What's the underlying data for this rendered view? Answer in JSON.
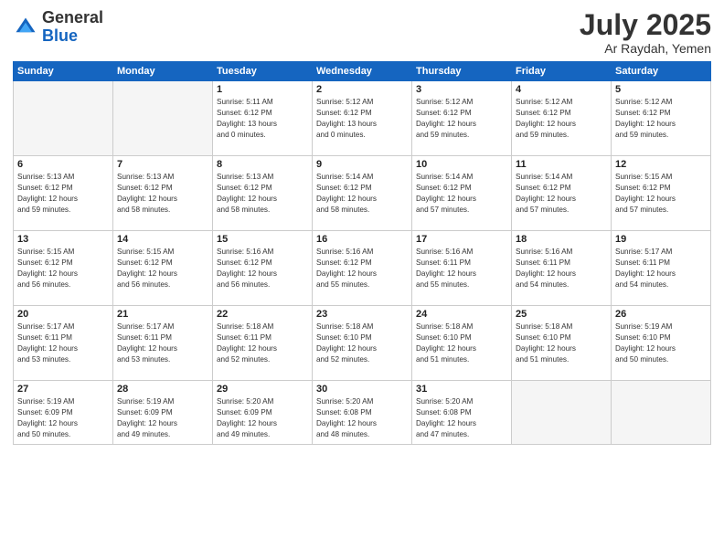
{
  "logo": {
    "general": "General",
    "blue": "Blue"
  },
  "header": {
    "title": "July 2025",
    "subtitle": "Ar Raydah, Yemen"
  },
  "days_of_week": [
    "Sunday",
    "Monday",
    "Tuesday",
    "Wednesday",
    "Thursday",
    "Friday",
    "Saturday"
  ],
  "weeks": [
    [
      {
        "day": "",
        "info": ""
      },
      {
        "day": "",
        "info": ""
      },
      {
        "day": "1",
        "info": "Sunrise: 5:11 AM\nSunset: 6:12 PM\nDaylight: 13 hours\nand 0 minutes."
      },
      {
        "day": "2",
        "info": "Sunrise: 5:12 AM\nSunset: 6:12 PM\nDaylight: 13 hours\nand 0 minutes."
      },
      {
        "day": "3",
        "info": "Sunrise: 5:12 AM\nSunset: 6:12 PM\nDaylight: 12 hours\nand 59 minutes."
      },
      {
        "day": "4",
        "info": "Sunrise: 5:12 AM\nSunset: 6:12 PM\nDaylight: 12 hours\nand 59 minutes."
      },
      {
        "day": "5",
        "info": "Sunrise: 5:12 AM\nSunset: 6:12 PM\nDaylight: 12 hours\nand 59 minutes."
      }
    ],
    [
      {
        "day": "6",
        "info": "Sunrise: 5:13 AM\nSunset: 6:12 PM\nDaylight: 12 hours\nand 59 minutes."
      },
      {
        "day": "7",
        "info": "Sunrise: 5:13 AM\nSunset: 6:12 PM\nDaylight: 12 hours\nand 58 minutes."
      },
      {
        "day": "8",
        "info": "Sunrise: 5:13 AM\nSunset: 6:12 PM\nDaylight: 12 hours\nand 58 minutes."
      },
      {
        "day": "9",
        "info": "Sunrise: 5:14 AM\nSunset: 6:12 PM\nDaylight: 12 hours\nand 58 minutes."
      },
      {
        "day": "10",
        "info": "Sunrise: 5:14 AM\nSunset: 6:12 PM\nDaylight: 12 hours\nand 57 minutes."
      },
      {
        "day": "11",
        "info": "Sunrise: 5:14 AM\nSunset: 6:12 PM\nDaylight: 12 hours\nand 57 minutes."
      },
      {
        "day": "12",
        "info": "Sunrise: 5:15 AM\nSunset: 6:12 PM\nDaylight: 12 hours\nand 57 minutes."
      }
    ],
    [
      {
        "day": "13",
        "info": "Sunrise: 5:15 AM\nSunset: 6:12 PM\nDaylight: 12 hours\nand 56 minutes."
      },
      {
        "day": "14",
        "info": "Sunrise: 5:15 AM\nSunset: 6:12 PM\nDaylight: 12 hours\nand 56 minutes."
      },
      {
        "day": "15",
        "info": "Sunrise: 5:16 AM\nSunset: 6:12 PM\nDaylight: 12 hours\nand 56 minutes."
      },
      {
        "day": "16",
        "info": "Sunrise: 5:16 AM\nSunset: 6:12 PM\nDaylight: 12 hours\nand 55 minutes."
      },
      {
        "day": "17",
        "info": "Sunrise: 5:16 AM\nSunset: 6:11 PM\nDaylight: 12 hours\nand 55 minutes."
      },
      {
        "day": "18",
        "info": "Sunrise: 5:16 AM\nSunset: 6:11 PM\nDaylight: 12 hours\nand 54 minutes."
      },
      {
        "day": "19",
        "info": "Sunrise: 5:17 AM\nSunset: 6:11 PM\nDaylight: 12 hours\nand 54 minutes."
      }
    ],
    [
      {
        "day": "20",
        "info": "Sunrise: 5:17 AM\nSunset: 6:11 PM\nDaylight: 12 hours\nand 53 minutes."
      },
      {
        "day": "21",
        "info": "Sunrise: 5:17 AM\nSunset: 6:11 PM\nDaylight: 12 hours\nand 53 minutes."
      },
      {
        "day": "22",
        "info": "Sunrise: 5:18 AM\nSunset: 6:11 PM\nDaylight: 12 hours\nand 52 minutes."
      },
      {
        "day": "23",
        "info": "Sunrise: 5:18 AM\nSunset: 6:10 PM\nDaylight: 12 hours\nand 52 minutes."
      },
      {
        "day": "24",
        "info": "Sunrise: 5:18 AM\nSunset: 6:10 PM\nDaylight: 12 hours\nand 51 minutes."
      },
      {
        "day": "25",
        "info": "Sunrise: 5:18 AM\nSunset: 6:10 PM\nDaylight: 12 hours\nand 51 minutes."
      },
      {
        "day": "26",
        "info": "Sunrise: 5:19 AM\nSunset: 6:10 PM\nDaylight: 12 hours\nand 50 minutes."
      }
    ],
    [
      {
        "day": "27",
        "info": "Sunrise: 5:19 AM\nSunset: 6:09 PM\nDaylight: 12 hours\nand 50 minutes."
      },
      {
        "day": "28",
        "info": "Sunrise: 5:19 AM\nSunset: 6:09 PM\nDaylight: 12 hours\nand 49 minutes."
      },
      {
        "day": "29",
        "info": "Sunrise: 5:20 AM\nSunset: 6:09 PM\nDaylight: 12 hours\nand 49 minutes."
      },
      {
        "day": "30",
        "info": "Sunrise: 5:20 AM\nSunset: 6:08 PM\nDaylight: 12 hours\nand 48 minutes."
      },
      {
        "day": "31",
        "info": "Sunrise: 5:20 AM\nSunset: 6:08 PM\nDaylight: 12 hours\nand 47 minutes."
      },
      {
        "day": "",
        "info": ""
      },
      {
        "day": "",
        "info": ""
      }
    ]
  ]
}
